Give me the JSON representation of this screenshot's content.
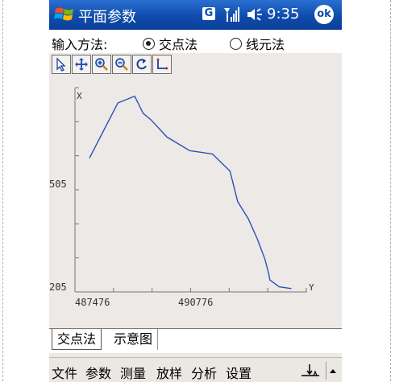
{
  "title_bar": {
    "title": "平面参数",
    "badge": "G",
    "time": "9:35",
    "ok_label": "ok"
  },
  "method": {
    "label": "输入方法:",
    "options": [
      {
        "label": "交点法",
        "selected": true
      },
      {
        "label": "线元法",
        "selected": false
      }
    ]
  },
  "toolbar": {
    "tools": [
      "pointer-icon",
      "pan-icon",
      "zoom-in-icon",
      "zoom-out-icon",
      "refresh-icon",
      "axes-icon"
    ]
  },
  "chart_data": {
    "type": "line",
    "title": "",
    "xlabel": "Y",
    "ylabel": "X",
    "x_ticks": [
      "487476",
      "490776"
    ],
    "y_ticks": [
      "505",
      "205"
    ],
    "x": [
      487890,
      488700,
      489180,
      489420,
      489650,
      490100,
      490750,
      491400,
      491900,
      492120,
      492420,
      492680,
      492900,
      493000,
      493040,
      493300,
      493650
    ],
    "y": [
      598,
      760,
      780,
      730,
      710,
      660,
      620,
      610,
      560,
      470,
      420,
      360,
      300,
      260,
      240,
      220,
      215
    ],
    "xlim": [
      487476,
      494100
    ],
    "ylim": [
      205,
      805
    ],
    "grid": false,
    "line_color": "#2a52b8"
  },
  "tabs": [
    {
      "label": "交点法",
      "active": true
    },
    {
      "label": "示意图",
      "active": false
    }
  ],
  "menu": {
    "items": [
      "文件",
      "参数",
      "测量",
      "放样",
      "分析",
      "设置"
    ]
  },
  "colors": {
    "titlebar": "#0f4cad",
    "plot_background": "#ece9e6"
  }
}
